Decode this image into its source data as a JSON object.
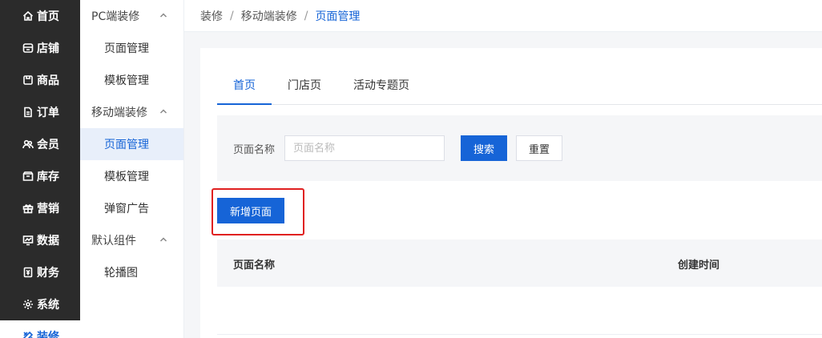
{
  "nav_primary": [
    {
      "label": "首页",
      "icon": "home-icon"
    },
    {
      "label": "店铺",
      "icon": "store-icon"
    },
    {
      "label": "商品",
      "icon": "product-icon"
    },
    {
      "label": "订单",
      "icon": "order-icon"
    },
    {
      "label": "会员",
      "icon": "member-icon"
    },
    {
      "label": "库存",
      "icon": "inventory-icon"
    },
    {
      "label": "营销",
      "icon": "gift-icon"
    },
    {
      "label": "数据",
      "icon": "chart-icon"
    },
    {
      "label": "财务",
      "icon": "finance-icon"
    },
    {
      "label": "系统",
      "icon": "settings-icon"
    },
    {
      "label": "装修",
      "icon": "decorate-icon",
      "active": true
    }
  ],
  "nav_secondary": {
    "groups": [
      {
        "label": "PC端装修",
        "items": [
          "页面管理",
          "模板管理"
        ]
      },
      {
        "label": "移动端装修",
        "items": [
          "页面管理",
          "模板管理",
          "弹窗广告"
        ]
      },
      {
        "label": "默认组件",
        "items": [
          "轮播图"
        ]
      }
    ],
    "active_item": "移动端装修/页面管理"
  },
  "breadcrumb": [
    "装修",
    "移动端装修",
    "页面管理"
  ],
  "tabs": [
    "首页",
    "门店页",
    "活动专题页"
  ],
  "active_tab": "首页",
  "filter": {
    "label": "页面名称",
    "placeholder": "页面名称",
    "value": "",
    "search_label": "搜索",
    "reset_label": "重置"
  },
  "add_button_label": "新增页面",
  "table": {
    "columns": [
      "页面名称",
      "创建时间"
    ],
    "rows": []
  },
  "colors": {
    "accent": "#1664d7",
    "nav_bg": "#2b2b2b",
    "highlight": "#e02020"
  }
}
